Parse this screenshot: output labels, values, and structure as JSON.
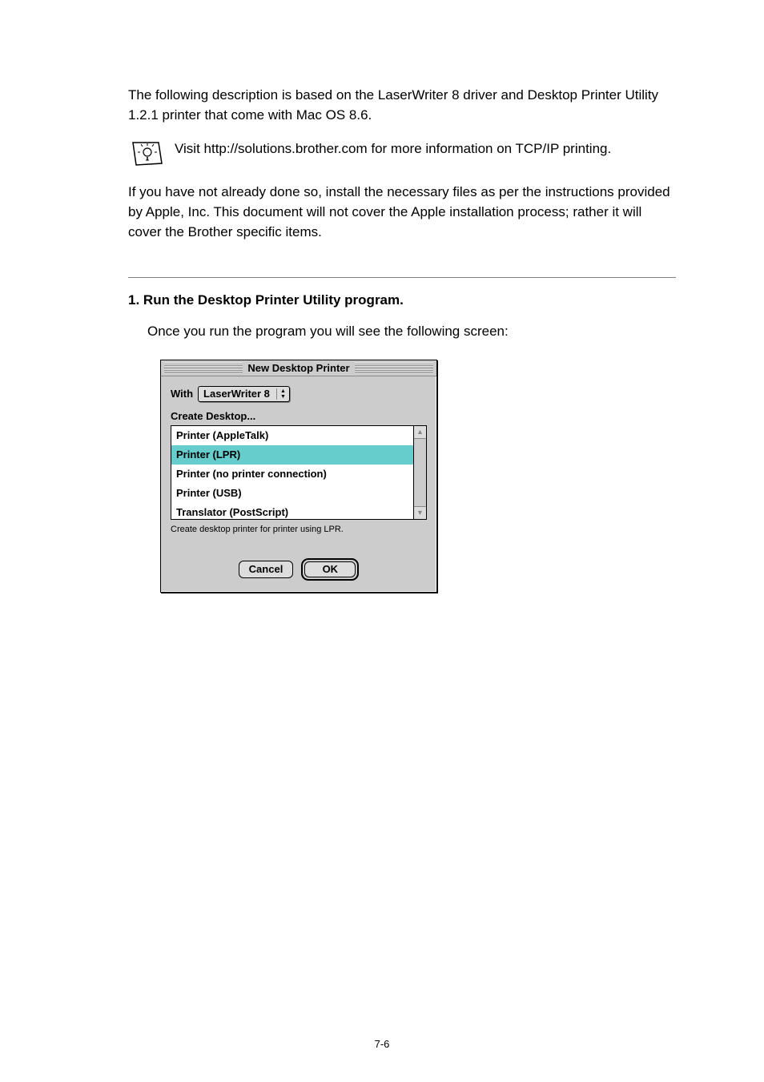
{
  "body": {
    "para1": "The following description is based on the LaserWriter 8 driver and Desktop Printer Utility 1.2.1 printer that come with Mac OS 8.6.",
    "tip": "Visit http://solutions.brother.com for more information on TCP/IP printing.",
    "para2": "If you have not already done so, install the necessary files as per the instructions provided by Apple, Inc. This document will not cover the Apple installation process; rather it will cover the Brother specific items.",
    "step_num": "1.",
    "step_title": "Run the Desktop Printer Utility program.",
    "step_sub": "Once you run the program you will see the following screen:"
  },
  "dialog": {
    "title": "New Desktop Printer",
    "with_label": "With",
    "popup_value": "LaserWriter 8",
    "create_label": "Create Desktop...",
    "list_items": [
      "Printer (AppleTalk)",
      "Printer (LPR)",
      "Printer (no printer connection)",
      "Printer (USB)",
      "Translator (PostScript)"
    ],
    "selected_index": 1,
    "hint": "Create desktop printer for printer using LPR.",
    "cancel": "Cancel",
    "ok": "OK"
  },
  "footer": "7-6"
}
